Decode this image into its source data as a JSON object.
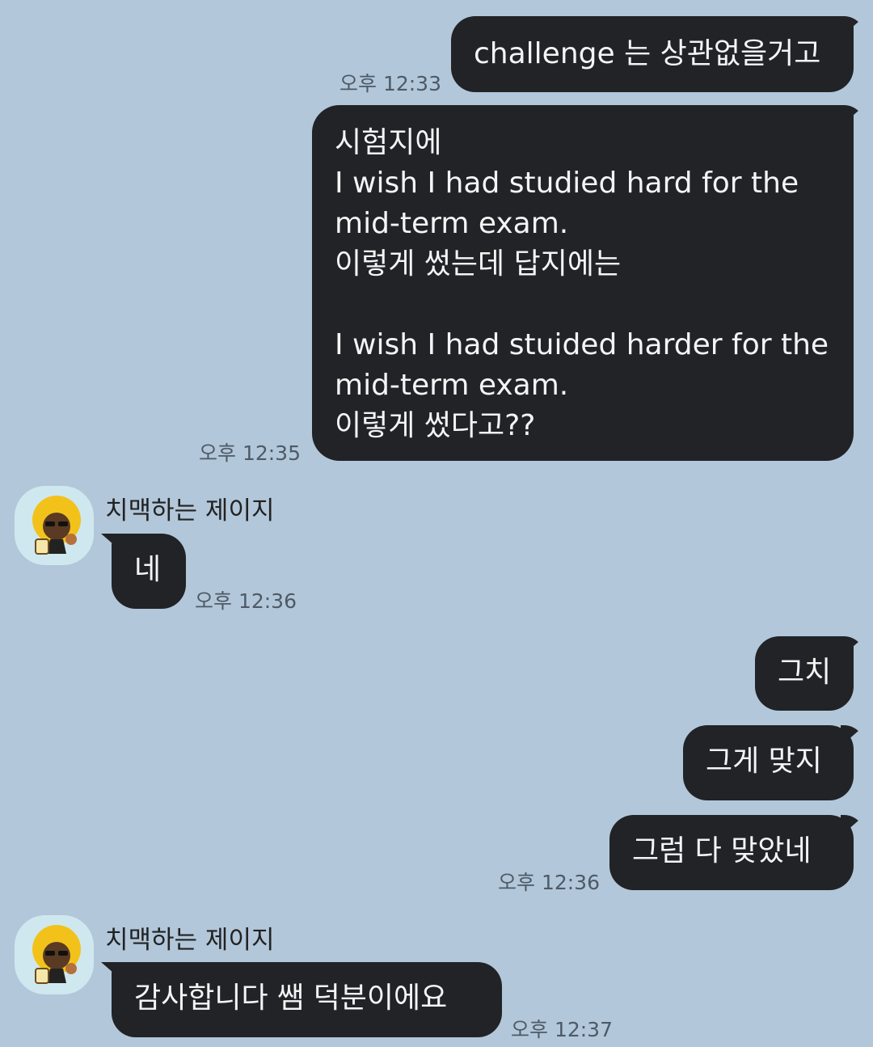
{
  "chat": {
    "contact_name": "치맥하는 제이지",
    "messages": [
      {
        "from": "me",
        "text": "challenge 는 상관없을거고",
        "time": "오후 12:33"
      },
      {
        "from": "me",
        "text": "시험지에\nI wish I had studied hard for the mid-term exam.\n이렇게 썼는데 답지에는\n\nI wish I had stuided harder for the mid-term exam.\n이렇게 썼다고??",
        "time": "오후 12:35"
      },
      {
        "from": "other",
        "text": "네",
        "time": "오후 12:36"
      },
      {
        "from": "me",
        "text": "그치",
        "time": ""
      },
      {
        "from": "me",
        "text": "그게 맞지",
        "time": ""
      },
      {
        "from": "me",
        "text": "그럼 다 맞았네",
        "time": "오후 12:36"
      },
      {
        "from": "other",
        "text": "감사합니다 쌤 덕분이에요",
        "time": "오후 12:37"
      }
    ]
  },
  "colors": {
    "background": "#b2c7da",
    "bubble": "#212327",
    "bubble_text": "#f4f4f4",
    "avatar_bg": "#cfe8ef"
  },
  "icons": {
    "avatar": "afro-character-with-beer-avatar"
  }
}
